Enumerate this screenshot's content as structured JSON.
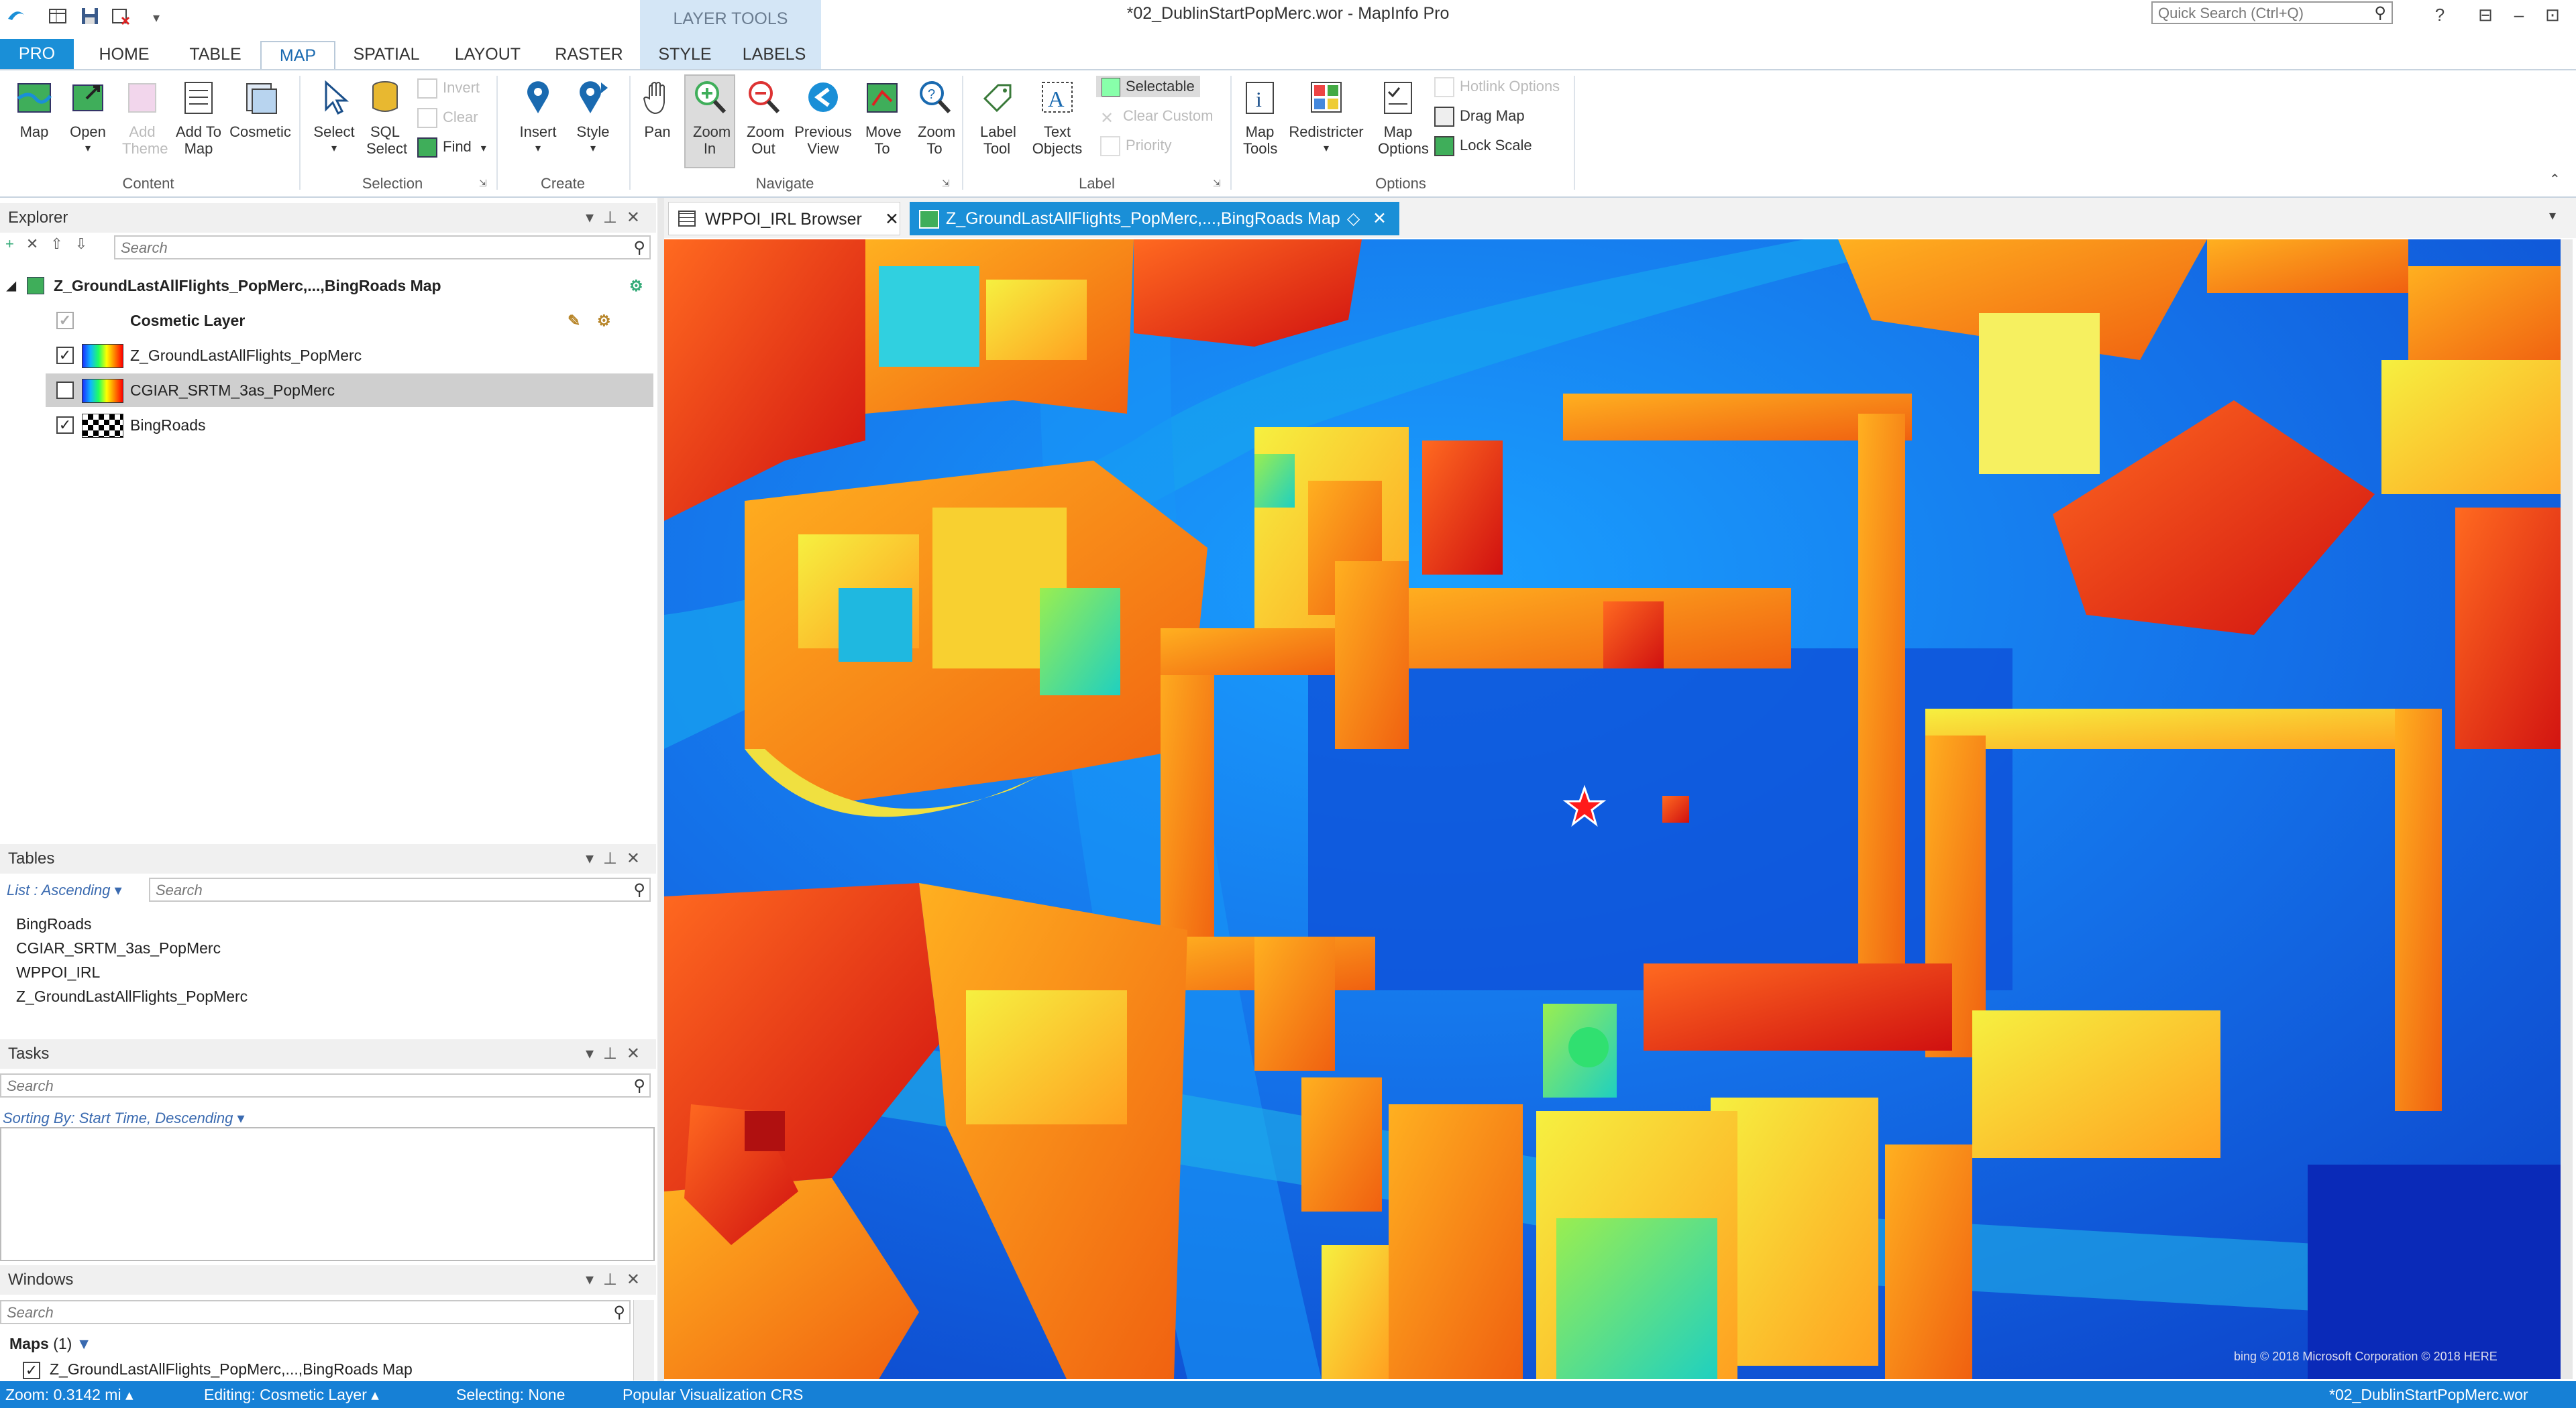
{
  "window": {
    "title": "*02_DublinStartPopMerc.wor - MapInfo Pro",
    "quick_search_placeholder": "Quick Search (Ctrl+Q)",
    "help": "?",
    "minimize": "–",
    "maximize": "⊡",
    "restore": "⊟"
  },
  "tabs": {
    "pro": "PRO",
    "home": "HOME",
    "table": "TABLE",
    "map": "MAP",
    "spatial": "SPATIAL",
    "layout": "LAYOUT",
    "raster": "RASTER",
    "layer_tools": "LAYER TOOLS",
    "style": "STYLE",
    "labels": "LABELS"
  },
  "ribbon": {
    "content": {
      "label": "Content",
      "map": "Map",
      "open": "Open",
      "add_theme": "Add Theme",
      "add_to_map": "Add To Map",
      "cosmetic": "Cosmetic"
    },
    "selection": {
      "label": "Selection",
      "select": "Select",
      "sql_select": "SQL Select",
      "invert": "Invert",
      "clear": "Clear",
      "find": "Find"
    },
    "create": {
      "label": "Create",
      "insert": "Insert",
      "style": "Style"
    },
    "navigate": {
      "label": "Navigate",
      "pan": "Pan",
      "zoom_in": "Zoom In",
      "zoom_out": "Zoom Out",
      "previous_view": "Previous View",
      "move_to": "Move To",
      "zoom_to": "Zoom To"
    },
    "label": {
      "label": "Label",
      "label_tool": "Label Tool",
      "text_objects": "Text Objects",
      "selectable": "Selectable",
      "clear_custom": "Clear Custom",
      "priority": "Priority"
    },
    "options": {
      "label": "Options",
      "map_tools": "Map Tools",
      "redistricter": "Redistricter",
      "map_options": "Map Options",
      "hotlink_options": "Hotlink Options",
      "drag_map": "Drag Map",
      "lock_scale": "Lock Scale"
    }
  },
  "explorer": {
    "title": "Explorer",
    "search_placeholder": "Search",
    "map_name": "Z_GroundLastAllFlights_PopMerc,...,BingRoads Map",
    "layers": [
      {
        "name": "Cosmetic Layer",
        "checked": true
      },
      {
        "name": "Z_GroundLastAllFlights_PopMerc",
        "checked": true
      },
      {
        "name": "CGIAR_SRTM_3as_PopMerc",
        "checked": false
      },
      {
        "name": "BingRoads",
        "checked": true
      }
    ]
  },
  "tables": {
    "title": "Tables",
    "sort": "List : Ascending",
    "search_placeholder": "Search",
    "items": [
      "BingRoads",
      "CGIAR_SRTM_3as_PopMerc",
      "WPPOI_IRL",
      "Z_GroundLastAllFlights_PopMerc"
    ]
  },
  "tasks": {
    "title": "Tasks",
    "search_placeholder": "Search",
    "sort": "Sorting By: Start Time, Descending"
  },
  "windows": {
    "title": "Windows",
    "search_placeholder": "Search",
    "maps_group": "Maps",
    "maps_count": "(1)",
    "map_item": "Z_GroundLastAllFlights_PopMerc,...,BingRoads Map"
  },
  "doc_tabs": [
    {
      "label": "WPPOI_IRL Browser"
    },
    {
      "label": "Z_GroundLastAllFlights_PopMerc,...,BingRoads Map"
    }
  ],
  "map": {
    "attribution": "bing  © 2018 Microsoft Corporation © 2018 HERE"
  },
  "status": {
    "zoom": "Zoom: 0.3142 mi",
    "editing": "Editing: Cosmetic Layer",
    "selecting": "Selecting: None",
    "crs": "Popular Visualization CRS",
    "workspace": "*02_DublinStartPopMerc.wor"
  },
  "colors": {
    "accent": "#1a8fd7",
    "status_bar": "#1680d6",
    "layer_tools_bg": "#d4e6f6",
    "active_doc_tab": "#1a8fd7"
  }
}
